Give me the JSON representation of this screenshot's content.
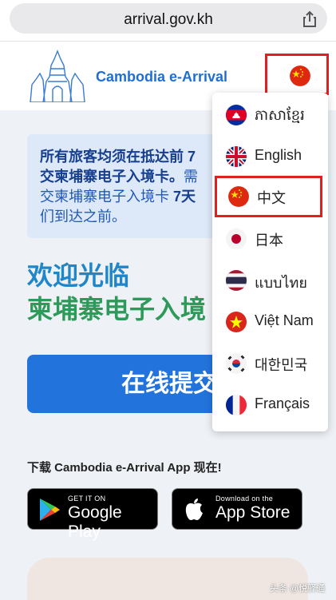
{
  "browser": {
    "url": "arrival.gov.kh"
  },
  "header": {
    "brand": "Cambodia e-Arrival"
  },
  "notice": {
    "line1_bold": "所有旅客均须在抵达前 7",
    "line2_bold": "交柬埔寨电子入境卡。",
    "line2_rest": "需",
    "line3_start": "交柬埔寨电子入境卡 ",
    "line3_bold": "7天",
    "line4": "们到达之前。"
  },
  "main": {
    "welcome_line1": "欢迎光临",
    "welcome_line2": "柬埔寨电子入境",
    "submit_label": "在线提交",
    "download_text": "下载 Cambodia e-Arrival App 现在!"
  },
  "stores": {
    "google": {
      "small": "GET IT ON",
      "big": "Google Play"
    },
    "apple": {
      "small": "Download on the",
      "big": "App Store"
    }
  },
  "languages": [
    {
      "label": "ភាសាខ្មែរ",
      "flag": "kh-flag-icon"
    },
    {
      "label": "English",
      "flag": "uk-flag-icon"
    },
    {
      "label": "中文",
      "flag": "cn-flag-icon",
      "selected": true
    },
    {
      "label": "日本",
      "flag": "jp-flag-icon"
    },
    {
      "label": "แบบไทย",
      "flag": "th-flag-icon"
    },
    {
      "label": "Việt Nam",
      "flag": "vn-flag-icon"
    },
    {
      "label": "대한민국",
      "flag": "kr-flag-icon"
    },
    {
      "label": "Français",
      "flag": "fr-flag-icon"
    }
  ],
  "watermark": "头条 @悦驿通",
  "colors": {
    "accent": "#2274dc",
    "highlight_border": "#e02020",
    "welcome_blue": "#1f86c9",
    "welcome_green": "#2e9a5a"
  }
}
